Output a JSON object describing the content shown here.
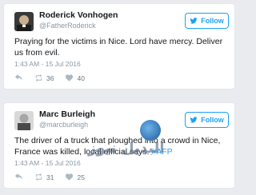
{
  "tweets": [
    {
      "name": "Roderick Vonhogen",
      "handle": "@FatherRoderick",
      "follow_label": "Follow",
      "text": "Praying for the victims in Nice. Lord have mercy. Deliver us from evil.",
      "time": "1:43 AM - 15 Jul 2016",
      "retweets": "36",
      "likes": "40"
    },
    {
      "name": "Marc Burleigh",
      "handle": "@marcburleigh",
      "follow_label": "Follow",
      "text_prefix": "The driver of a truck that ploughed into a crowd in Nice, France was killed, local official says.",
      "hashtag": "#AFP",
      "time": "1:43 AM - 15 Jul 2016",
      "retweets": "31",
      "likes": "25"
    }
  ],
  "watermark": "البديل نيوز",
  "colors": {
    "accent": "#1da1f2",
    "muted": "#8899a6",
    "icon": "#aab8c2"
  }
}
